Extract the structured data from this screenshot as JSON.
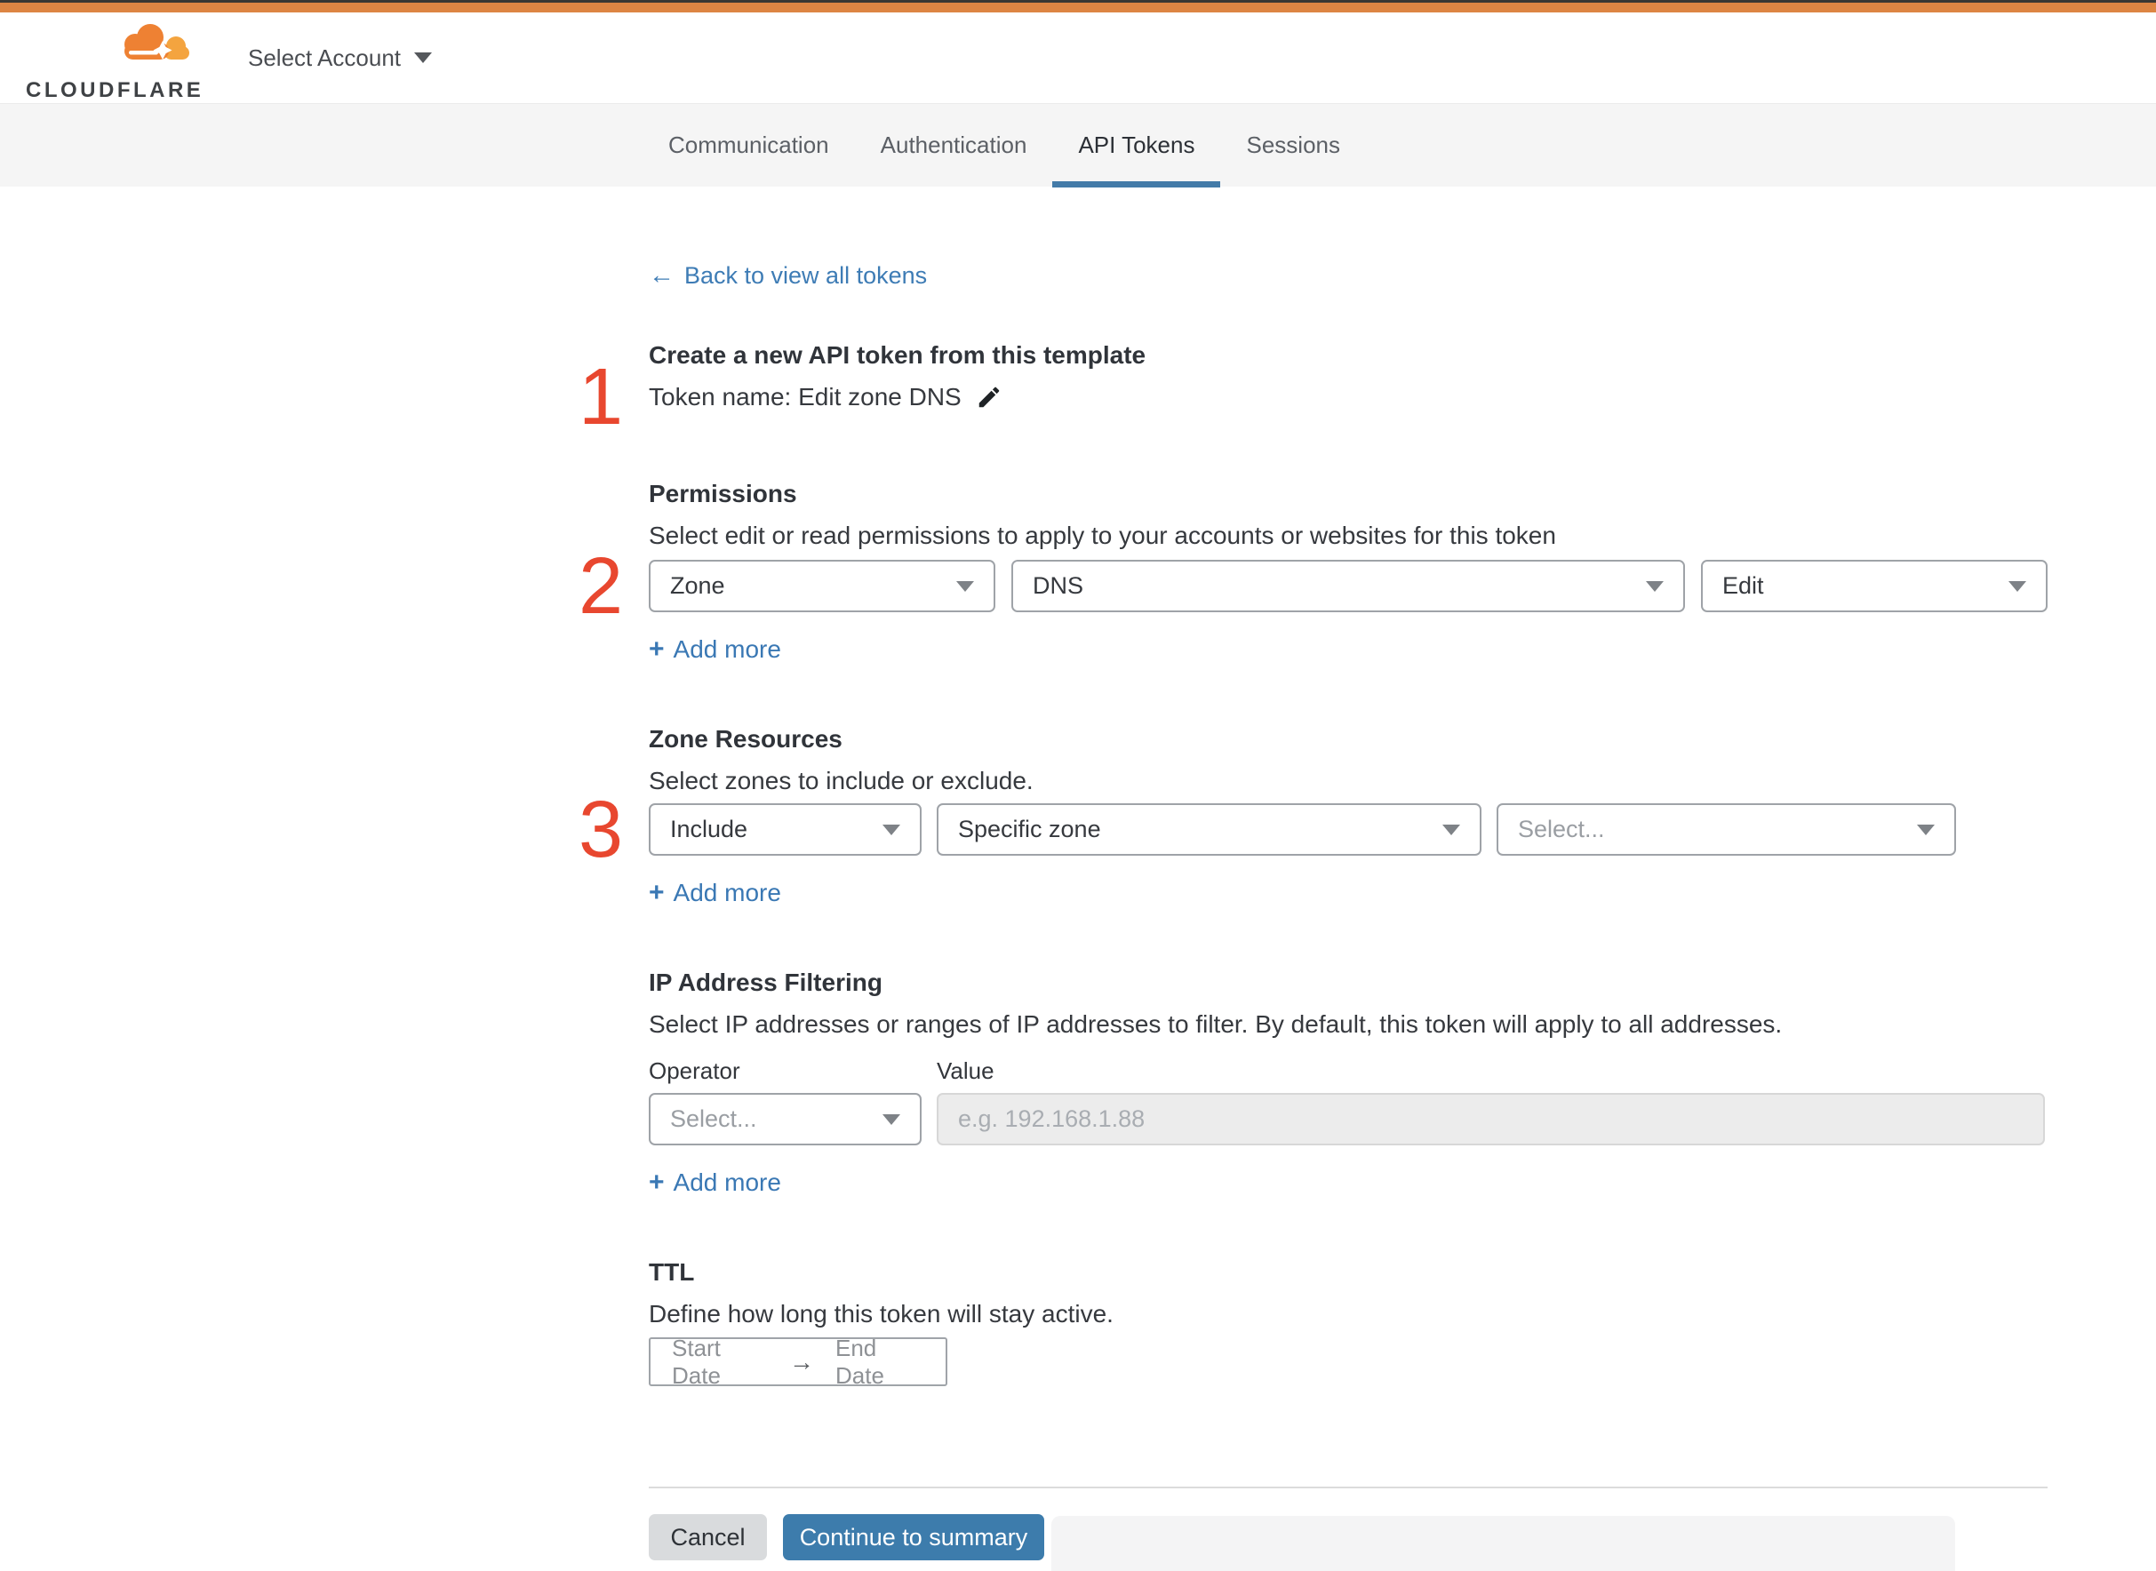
{
  "header": {
    "brand_wordmark": "CLOUDFLARE",
    "account_selector_label": "Select Account"
  },
  "tabs": {
    "items": [
      {
        "label": "Communication",
        "active": false
      },
      {
        "label": "Authentication",
        "active": false
      },
      {
        "label": "API Tokens",
        "active": true
      },
      {
        "label": "Sessions",
        "active": false
      }
    ]
  },
  "back_link": {
    "arrow_icon": "←",
    "label": "Back to view all tokens"
  },
  "steps": {
    "one": "1",
    "two": "2",
    "three": "3"
  },
  "token_template": {
    "heading": "Create a new API token from this template",
    "token_name": "Token name: Edit zone DNS"
  },
  "permissions": {
    "heading": "Permissions",
    "description": "Select edit or read permissions to apply to your accounts or websites for this token",
    "scope_value": "Zone",
    "service_value": "DNS",
    "access_value": "Edit",
    "plus": "+",
    "add_more_label": "Add more"
  },
  "zone_resources": {
    "heading": "Zone Resources",
    "description": "Select zones to include or exclude.",
    "mode_value": "Include",
    "type_value": "Specific zone",
    "zone_placeholder": "Select...",
    "plus": "+",
    "add_more_label": "Add more"
  },
  "ip_filtering": {
    "heading": "IP Address Filtering",
    "description": "Select IP addresses or ranges of IP addresses to filter. By default, this token will apply to all addresses.",
    "operator_label": "Operator",
    "value_label": "Value",
    "operator_placeholder": "Select...",
    "value_placeholder": "e.g. 192.168.1.88",
    "plus": "+",
    "add_more_label": "Add more"
  },
  "ttl": {
    "heading": "TTL",
    "description": "Define how long this token will stay active.",
    "start_label": "Start Date",
    "arrow_icon": "→",
    "end_label": "End Date"
  },
  "footer": {
    "cancel_label": "Cancel",
    "continue_label": "Continue to summary"
  },
  "colors": {
    "topbar_orange": "#dd8543",
    "tab_underline_blue": "#447ba8",
    "link_blue": "#3a78b4",
    "button_blue": "#3d7cac",
    "step_marker_red": "#e8472f"
  }
}
